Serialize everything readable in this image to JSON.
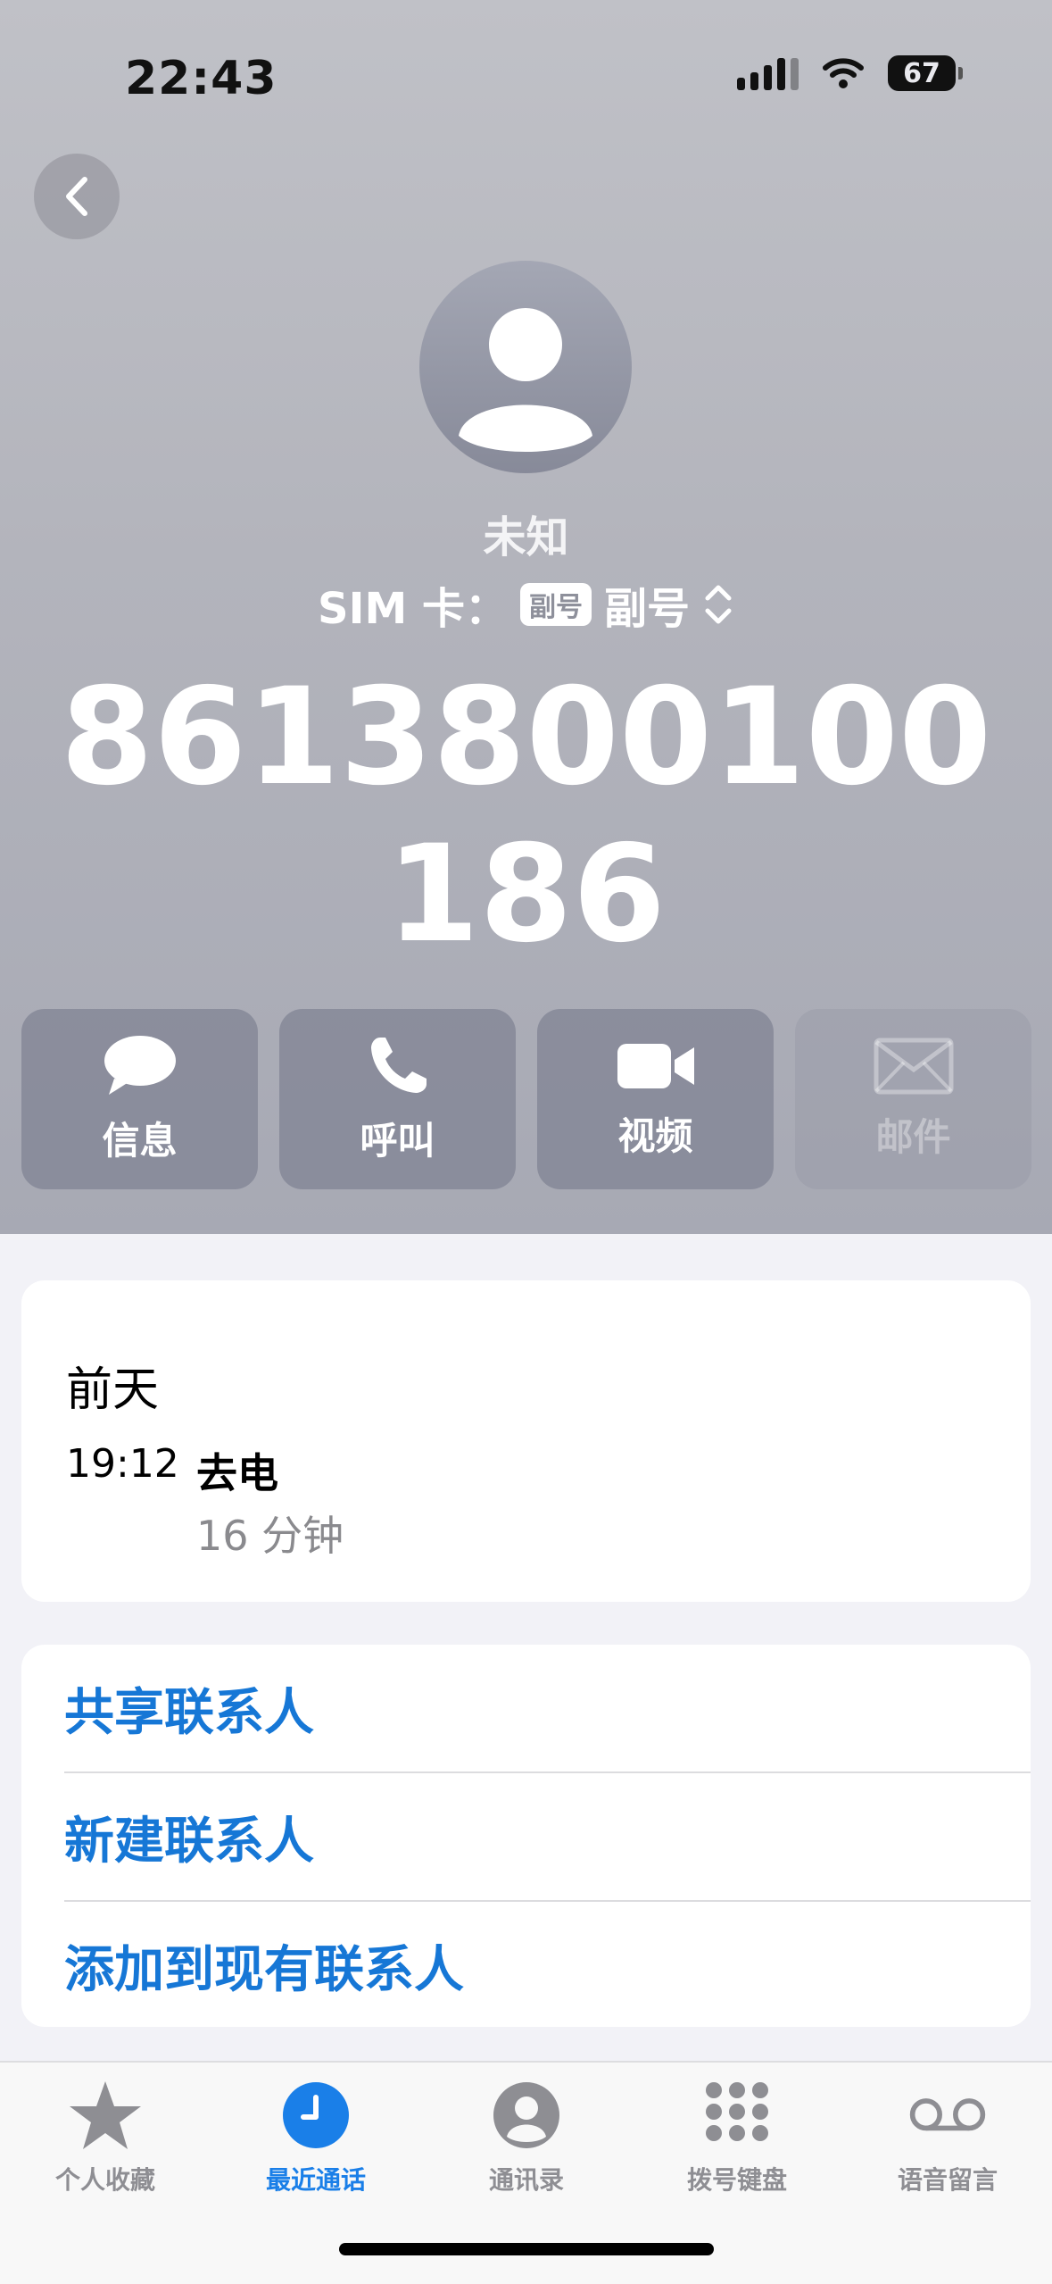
{
  "status_bar": {
    "time": "22:43",
    "battery": "67"
  },
  "contact": {
    "name": "未知",
    "sim_label": "SIM 卡：",
    "sim_badge": "副号",
    "sim_value": "副号",
    "number": "8613800100186"
  },
  "actions": [
    {
      "label": "信息",
      "icon": "message-icon",
      "enabled": true
    },
    {
      "label": "呼叫",
      "icon": "phone-icon",
      "enabled": true
    },
    {
      "label": "视频",
      "icon": "video-icon",
      "enabled": true
    },
    {
      "label": "邮件",
      "icon": "mail-icon",
      "enabled": false
    }
  ],
  "history": {
    "day": "前天",
    "time": "19:12",
    "type": "去电",
    "duration": "16 分钟"
  },
  "options": [
    "共享联系人",
    "新建联系人",
    "添加到现有联系人"
  ],
  "tabbar": {
    "active_index": 1,
    "items": [
      {
        "label": "个人收藏",
        "icon": "star-icon"
      },
      {
        "label": "最近通话",
        "icon": "clock-icon"
      },
      {
        "label": "通讯录",
        "icon": "person-icon"
      },
      {
        "label": "拨号键盘",
        "icon": "keypad-icon"
      },
      {
        "label": "语音留言",
        "icon": "voicemail-icon"
      }
    ]
  },
  "colors": {
    "accent": "#1677d6",
    "tab_active": "#1a7fe8",
    "inactive": "#8e8e93"
  }
}
